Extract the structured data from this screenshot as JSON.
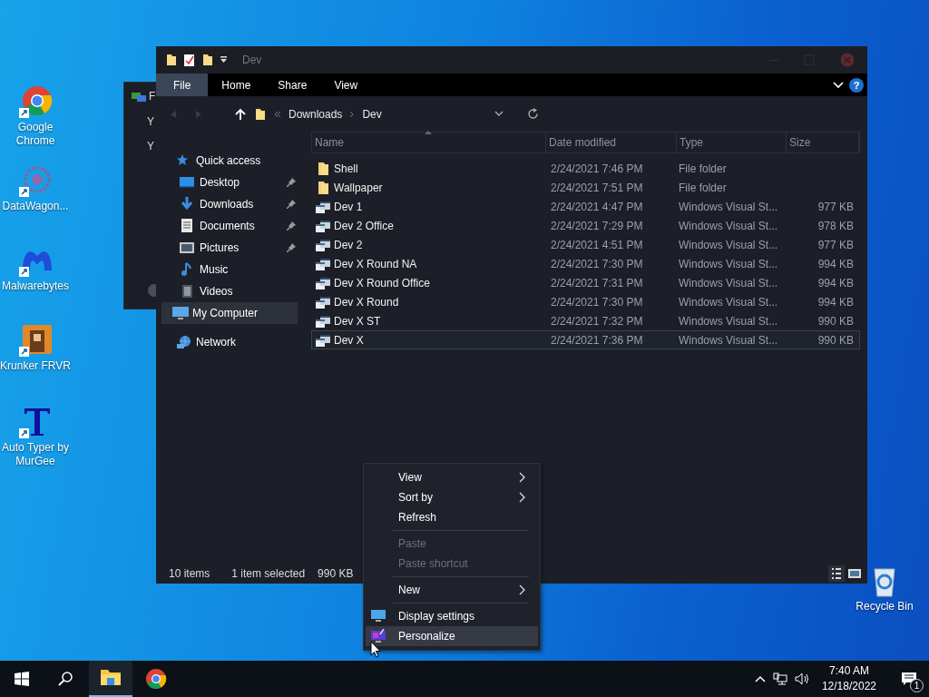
{
  "desktop_icons": [
    {
      "label": "Google Chrome",
      "kind": "chrome"
    },
    {
      "label": "DataWagon...",
      "kind": "datawagon"
    },
    {
      "label": "Malwarebytes",
      "kind": "malware"
    },
    {
      "label": "Krunker FRVR",
      "kind": "game"
    },
    {
      "label": "Auto Typer by MurGee",
      "kind": "typer"
    },
    {
      "label": "Recycle Bin",
      "kind": "recycle"
    }
  ],
  "back_window": {
    "title": "F",
    "lines": [
      "Y",
      "Y"
    ]
  },
  "explorer": {
    "title": "Dev",
    "help": "?",
    "ribbon_tabs": [
      {
        "label": "File",
        "selected": true
      },
      {
        "label": "Home",
        "selected": false
      },
      {
        "label": "Share",
        "selected": false
      },
      {
        "label": "View",
        "selected": false
      }
    ],
    "breadcrumb": [
      "Downloads",
      "Dev"
    ],
    "nav": [
      {
        "label": "Quick access",
        "kind": "star",
        "selected": false,
        "children": [
          {
            "label": "Desktop",
            "kind": "desktop",
            "pinned": true,
            "selected": false
          },
          {
            "label": "Downloads",
            "kind": "download",
            "pinned": true,
            "selected": false
          },
          {
            "label": "Documents",
            "kind": "document",
            "pinned": true,
            "selected": false
          },
          {
            "label": "Pictures",
            "kind": "picture",
            "pinned": true,
            "selected": false
          },
          {
            "label": "Music",
            "kind": "music",
            "pinned": false,
            "selected": false
          },
          {
            "label": "Videos",
            "kind": "video",
            "pinned": false,
            "selected": false
          }
        ]
      },
      {
        "label": "My Computer",
        "kind": "computer",
        "selected": true
      },
      {
        "label": "Network",
        "kind": "network",
        "selected": false
      }
    ],
    "columns": [
      "Name",
      "Date modified",
      "Type",
      "Size"
    ],
    "rows": [
      {
        "name": "Shell",
        "date": "2/24/2021 7:46 PM",
        "type": "File folder",
        "size": "",
        "kind": "folder",
        "selected": false
      },
      {
        "name": "Wallpaper",
        "date": "2/24/2021 7:51 PM",
        "type": "File folder",
        "size": "",
        "kind": "folder",
        "selected": false
      },
      {
        "name": "Dev 1",
        "date": "2/24/2021 4:47 PM",
        "type": "Windows Visual St...",
        "size": "977 KB",
        "kind": "style",
        "selected": false
      },
      {
        "name": "Dev 2 Office",
        "date": "2/24/2021 7:29 PM",
        "type": "Windows Visual St...",
        "size": "978 KB",
        "kind": "style",
        "selected": false
      },
      {
        "name": "Dev 2",
        "date": "2/24/2021 4:51 PM",
        "type": "Windows Visual St...",
        "size": "977 KB",
        "kind": "style",
        "selected": false
      },
      {
        "name": "Dev X Round NA",
        "date": "2/24/2021 7:30 PM",
        "type": "Windows Visual St...",
        "size": "994 KB",
        "kind": "style",
        "selected": false
      },
      {
        "name": "Dev X Round Office",
        "date": "2/24/2021 7:31 PM",
        "type": "Windows Visual St...",
        "size": "994 KB",
        "kind": "style",
        "selected": false
      },
      {
        "name": "Dev X Round",
        "date": "2/24/2021 7:30 PM",
        "type": "Windows Visual St...",
        "size": "994 KB",
        "kind": "style",
        "selected": false
      },
      {
        "name": "Dev X ST",
        "date": "2/24/2021 7:32 PM",
        "type": "Windows Visual St...",
        "size": "990 KB",
        "kind": "style",
        "selected": false
      },
      {
        "name": "Dev X",
        "date": "2/24/2021 7:36 PM",
        "type": "Windows Visual St...",
        "size": "990 KB",
        "kind": "style",
        "selected": true
      }
    ],
    "status": {
      "count": "10 items",
      "selection": "1 item selected",
      "size": "990 KB"
    }
  },
  "context_menu": [
    {
      "kind": "item",
      "label": "View",
      "submenu": true,
      "disabled": false,
      "selected": false
    },
    {
      "kind": "item",
      "label": "Sort by",
      "submenu": true,
      "disabled": false,
      "selected": false
    },
    {
      "kind": "item",
      "label": "Refresh",
      "submenu": false,
      "disabled": false,
      "selected": false
    },
    {
      "kind": "separator"
    },
    {
      "kind": "item",
      "label": "Paste",
      "submenu": false,
      "disabled": true,
      "selected": false
    },
    {
      "kind": "item",
      "label": "Paste shortcut",
      "submenu": false,
      "disabled": true,
      "selected": false
    },
    {
      "kind": "separator"
    },
    {
      "kind": "item",
      "label": "New",
      "submenu": true,
      "disabled": false,
      "selected": false
    },
    {
      "kind": "separator"
    },
    {
      "kind": "display",
      "label": "Display settings",
      "submenu": false,
      "disabled": false,
      "selected": false
    },
    {
      "kind": "personalize",
      "label": "Personalize",
      "submenu": false,
      "disabled": false,
      "selected": true
    }
  ],
  "taskbar": {
    "apps": [
      {
        "kind": "explorer",
        "active": true
      },
      {
        "kind": "chrome",
        "active": false
      }
    ],
    "time": "7:40 AM",
    "date": "12/18/2022",
    "notifications": "1"
  }
}
